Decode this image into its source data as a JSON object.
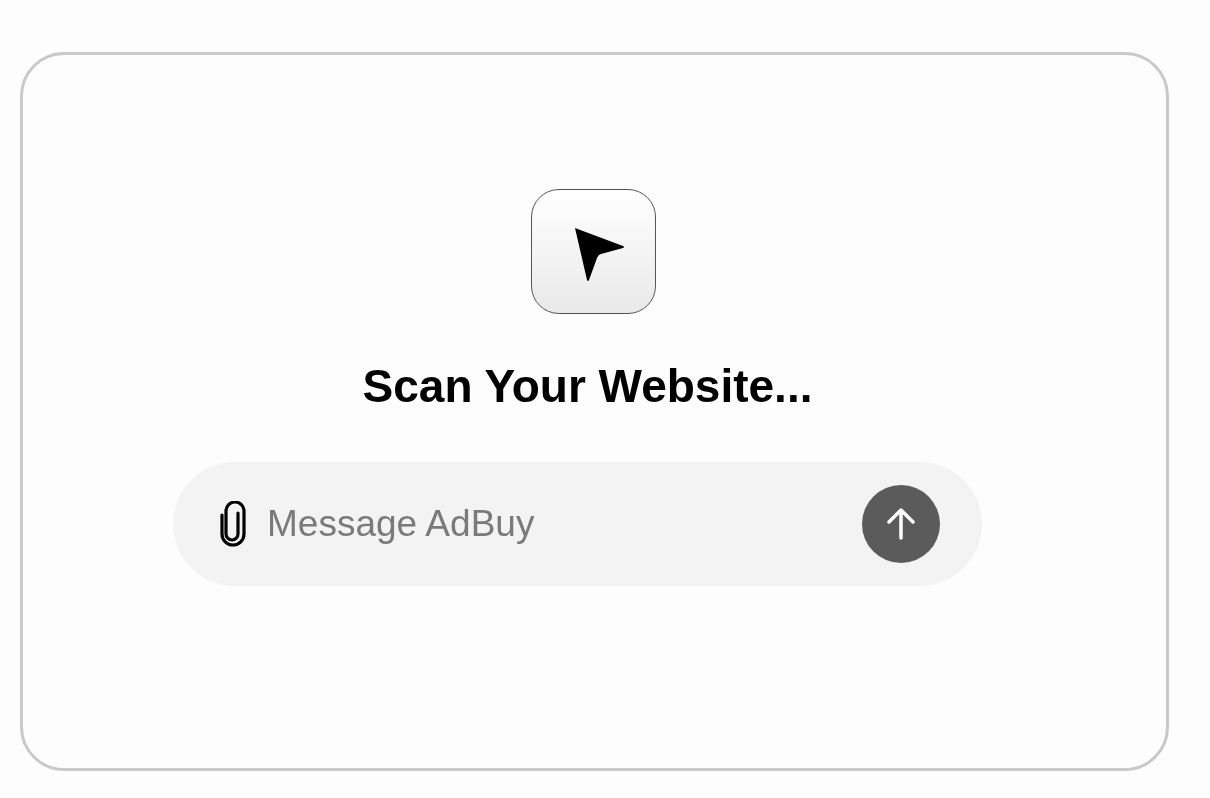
{
  "heading": "Scan Your Website...",
  "message_field": {
    "placeholder": "Message AdBuy"
  }
}
